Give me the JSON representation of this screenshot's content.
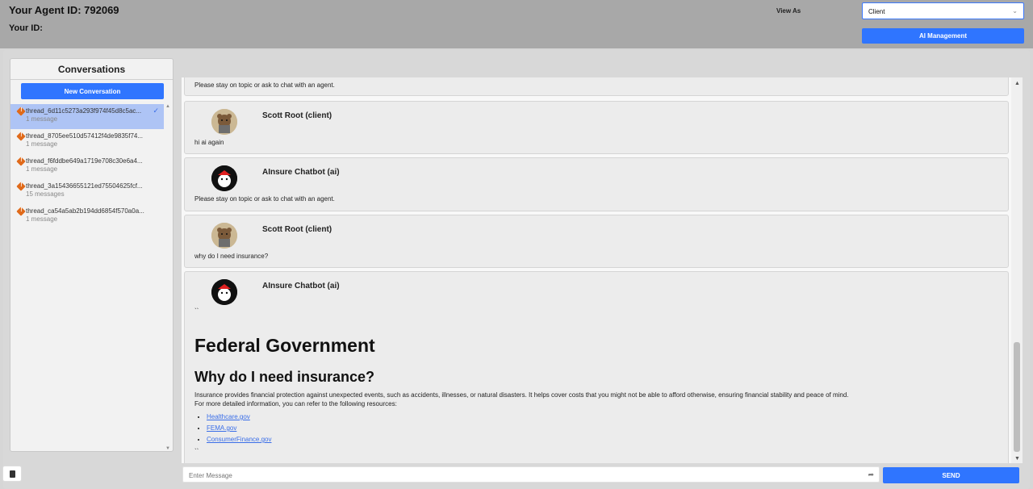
{
  "header": {
    "agent_id_label": "Your Agent ID: 792069",
    "your_id_label": "Your ID:",
    "view_as_label": "View As",
    "view_as_value": "Client",
    "ai_management_label": "AI Management"
  },
  "sidebar": {
    "title": "Conversations",
    "new_conversation_label": "New Conversation",
    "threads": [
      {
        "name": "thread_6d11c5273a293f974f45d8c5ac...",
        "count": "1 message",
        "active": true
      },
      {
        "name": "thread_8705ee510d57412f4de9835f74...",
        "count": "1 message",
        "active": false
      },
      {
        "name": "thread_f6fddbe649a1719e708c30e6a4...",
        "count": "1 message",
        "active": false
      },
      {
        "name": "thread_3a15436655121ed75504625fcf...",
        "count": "15 messages",
        "active": false
      },
      {
        "name": "thread_ca54a5ab2b194dd6854f570a0a...",
        "count": "1 message",
        "active": false
      }
    ]
  },
  "chat": {
    "partial_top_text": "Please stay on topic or ask to chat with an agent.",
    "messages": [
      {
        "sender": "Scott Root (client)",
        "text": "hi ai again"
      },
      {
        "sender": "AInsure Chatbot (ai)",
        "text": "Please stay on topic or ask to chat with an agent."
      },
      {
        "sender": "Scott Root (client)",
        "text": "why do I need insurance?"
      },
      {
        "sender": "AInsure Chatbot (ai)",
        "text": "``"
      }
    ],
    "rich": {
      "h1": "Federal Government",
      "h2": "Why do I need insurance?",
      "p1": "Insurance provides financial protection against unexpected events, such as accidents, illnesses, or natural disasters. It helps cover costs that you might not be able to afford otherwise, ensuring financial stability and peace of mind.",
      "p2": "For more detailed information, you can refer to the following resources:",
      "links": [
        "Healthcare.gov",
        "FEMA.gov",
        "ConsumerFinance.gov"
      ],
      "closing": "``"
    }
  },
  "composer": {
    "placeholder": "Enter Message",
    "send_label": "SEND"
  },
  "colors": {
    "accent": "#2f75ff",
    "topbar": "#a8a8a8",
    "warning": "#e06a1a"
  }
}
